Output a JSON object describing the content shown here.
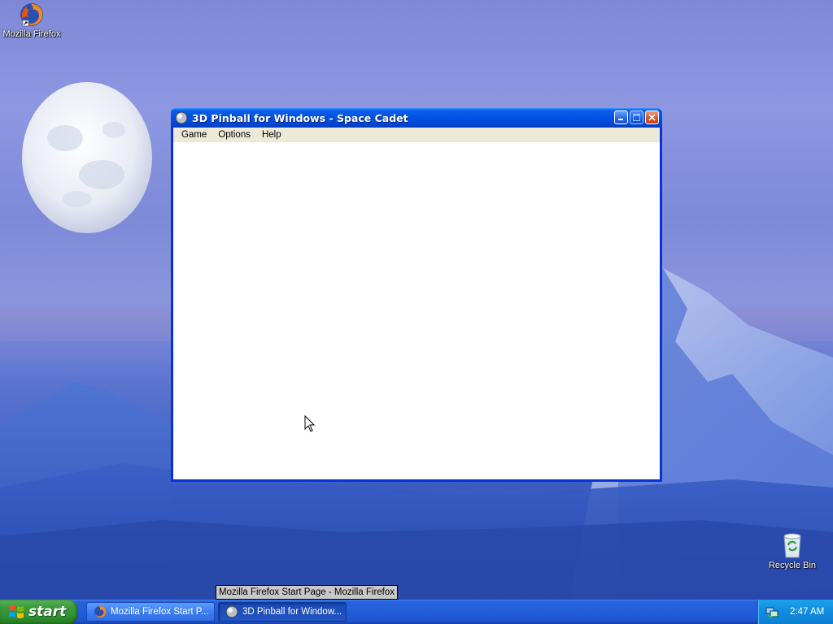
{
  "desktop": {
    "icons": [
      {
        "label": "Mozilla Firefox",
        "icon": "firefox-icon"
      },
      {
        "label": "Recycle Bin",
        "icon": "recycle-bin-icon"
      }
    ]
  },
  "window": {
    "title": "3D Pinball for Windows - Space Cadet",
    "icon": "pinball-icon",
    "menu": [
      "Game",
      "Options",
      "Help"
    ],
    "buttons": [
      "minimize-icon",
      "maximize-icon",
      "close-icon"
    ]
  },
  "tooltip": "Mozilla Firefox Start Page - Mozilla Firefox",
  "taskbar": {
    "start_label": "start",
    "tasks": [
      {
        "label": "Mozilla Firefox Start P...",
        "icon": "firefox-icon",
        "active": false
      },
      {
        "label": "3D Pinball for Window...",
        "icon": "pinball-icon",
        "active": true
      }
    ],
    "tray": {
      "clock": "2:47 AM",
      "icon": "network-icon"
    }
  },
  "colors": {
    "titlebar": "#0054e3",
    "taskbar": "#245edb",
    "start_button": "#3c9a3c",
    "tray": "#138fe0",
    "close_button": "#e0532a",
    "menubar": "#ece9d8"
  }
}
